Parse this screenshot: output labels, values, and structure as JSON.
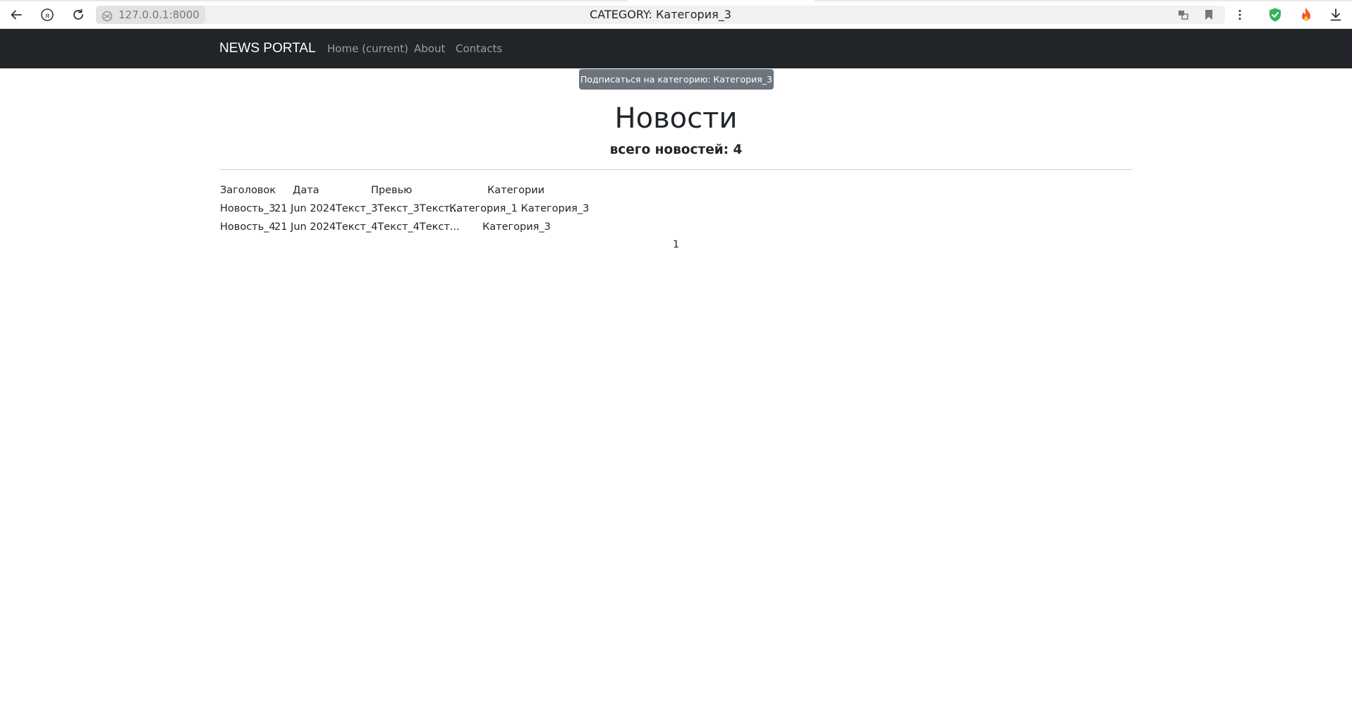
{
  "browser": {
    "url": "127.0.0.1:8000",
    "tab_title": "CATEGORY: Категория_3",
    "icons": [
      "back-arrow-icon",
      "yandex-icon",
      "reload-icon",
      "site-info-icon",
      "translate-icon",
      "bookmark-icon",
      "menu-dots-icon",
      "shield-check-icon",
      "flame-icon",
      "download-icon"
    ]
  },
  "navbar": {
    "brand": "NEWS PORTAL",
    "links": [
      "Home (current)",
      "About",
      "Contacts"
    ]
  },
  "subscribe": {
    "label": "Подписаться на категорию: Категория_3"
  },
  "content": {
    "title": "Новости",
    "subtitle": "всего новостей: 4"
  },
  "table": {
    "headers": [
      "Заголовок",
      "Дата",
      "Превью",
      "Категории"
    ],
    "rows": [
      {
        "title": "Новость_3",
        "date": "21 Jun 2024",
        "preview": "Текст_3Текст_3Текст...",
        "categories": "Категория_1 Категория_3"
      },
      {
        "title": "Новость_4",
        "date": "21 Jun 2024",
        "preview": "Текст_4Текст_4Текст...",
        "categories": "Категория_3"
      }
    ]
  },
  "pagination": {
    "current": "1"
  },
  "colors": {
    "navbar_bg": "#212529",
    "button_bg": "#6c757d",
    "shield": "#35b35a",
    "flame": "#ef5a2b"
  }
}
